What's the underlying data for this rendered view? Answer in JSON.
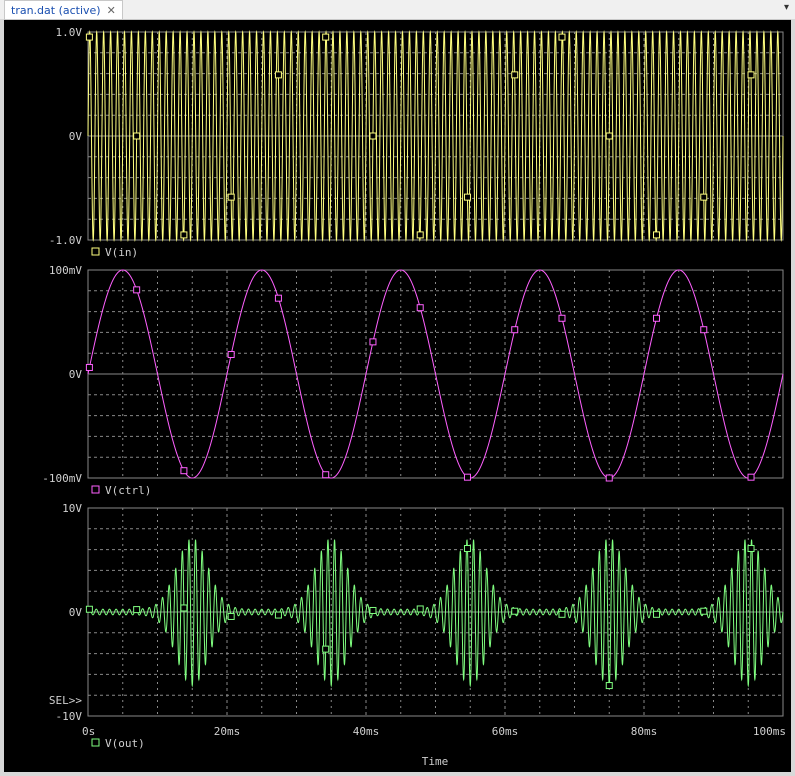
{
  "window": {
    "tab_label": "tran.dat (active)",
    "close_icon": "close-icon",
    "menu_icon": "chevron-down-icon"
  },
  "colors": {
    "background": "#000000",
    "grid": "#888888",
    "text": "#d0d0d0",
    "v_in": "#ffff80",
    "v_ctrl": "#ff60ff",
    "v_out": "#80ff80"
  },
  "x_axis": {
    "label": "Time",
    "range_ms": [
      0,
      100
    ],
    "ticks_ms": [
      0,
      20,
      40,
      60,
      80,
      100
    ],
    "tick_labels": [
      "0s",
      "20ms",
      "40ms",
      "60ms",
      "80ms",
      "100ms"
    ]
  },
  "sel_label": "SEL>>",
  "chart_data": [
    {
      "type": "line",
      "series": [
        {
          "name": "V(in)",
          "carrier_frequency_hz": 1000,
          "amplitude_v": 1.0
        }
      ],
      "ylim": [
        -1.0,
        1.0
      ],
      "y_ticks": [
        1.0,
        0,
        -1.0
      ],
      "y_tick_labels": [
        "1.0V",
        "0V",
        "-1.0V"
      ],
      "legend": "V(in)",
      "marker": "square",
      "grid": true
    },
    {
      "type": "line",
      "series": [
        {
          "name": "V(ctrl)",
          "frequency_hz": 50,
          "amplitude_v": 0.1
        }
      ],
      "ylim": [
        -0.1,
        0.1
      ],
      "y_ticks": [
        0.1,
        0,
        -0.1
      ],
      "y_tick_labels": [
        "100mV",
        "0V",
        "-100mV"
      ],
      "legend": "V(ctrl)",
      "marker": "square",
      "grid": true
    },
    {
      "type": "line",
      "series": [
        {
          "name": "V(out)",
          "burst_peak_times_ms": [
            15,
            35,
            55,
            75,
            95
          ],
          "peak_amplitude_v": 6.8
        }
      ],
      "ylim": [
        -10,
        10
      ],
      "y_ticks": [
        10,
        0,
        -10
      ],
      "y_tick_labels": [
        "10V",
        "0V",
        "-10V"
      ],
      "legend": "V(out)",
      "marker": "square",
      "grid": true
    }
  ]
}
